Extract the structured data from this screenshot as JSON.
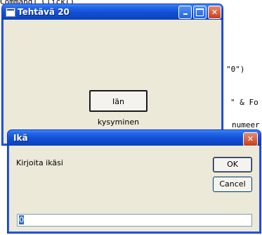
{
  "background_code": {
    "line0": "Command1_Click()",
    "line1": "\"0\")",
    "line2": "\" & Fo",
    "line3": "numeer"
  },
  "main_window": {
    "title": "Tehtävä 20",
    "button_label": "Iän kysyminen"
  },
  "input_dialog": {
    "title": "Ikä",
    "prompt": "Kirjoita ikäsi",
    "ok_label": "OK",
    "cancel_label": "Cancel",
    "input_value": "0"
  },
  "colors": {
    "titlebar": "#0a3fb8",
    "window_face": "#ece9d8",
    "close_button": "#c4401d"
  }
}
